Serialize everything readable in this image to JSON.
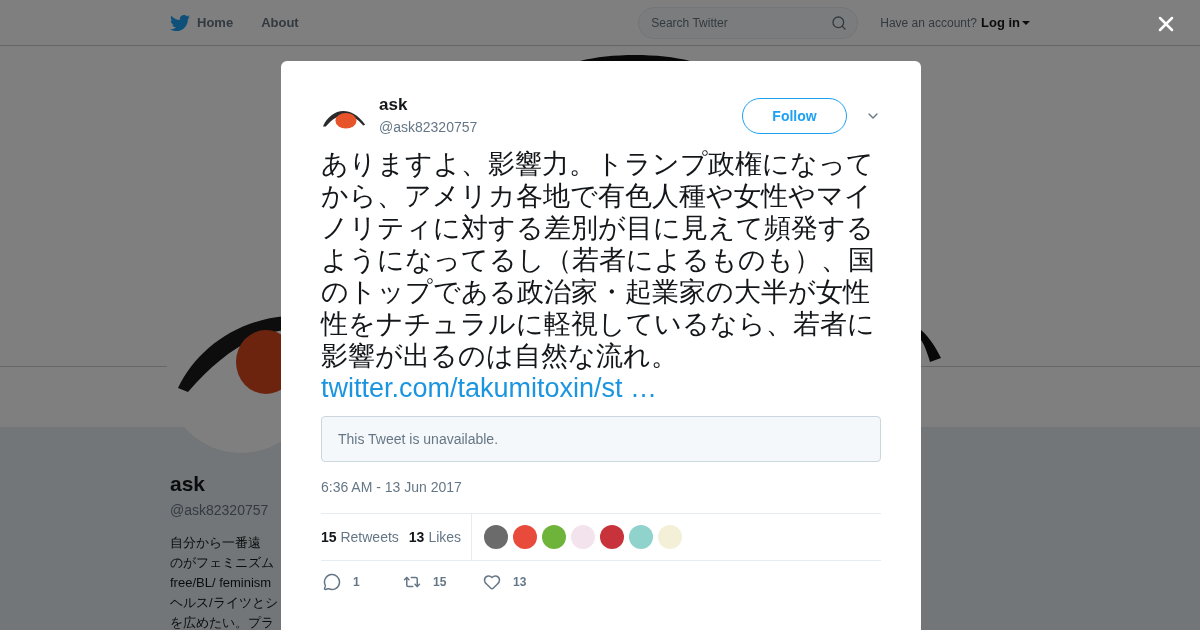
{
  "header": {
    "nav": [
      "Home",
      "About"
    ],
    "search": {
      "placeholder": "Search Twitter"
    },
    "account_prompt": "Have an account?",
    "login": "Log in"
  },
  "profile": {
    "name": "ask",
    "handle": "@ask82320757",
    "bio_lines": [
      "自分から一番遠",
      "のがフェミニズム",
      "free/BL/ feminism",
      "ヘルス/ライツとシ",
      "を広めたい。プラ"
    ]
  },
  "tweet": {
    "author": {
      "name": "ask",
      "handle": "@ask82320757"
    },
    "follow_button": "Follow",
    "text": "ありますよ、影響力。トランプ政権になってから、アメリカ各地で有色人種や女性やマイノリティに対する差別が目に見えて頻発するようになってるし（若者によるものも）、国のトップである政治家・起業家の大半が女性性をナチュラルに軽視しているなら、若者に影響が出るのは自然な流れ。",
    "link": "twitter.com/takumitoxin/st …",
    "quoted_notice": "This Tweet is unavailable.",
    "timestamp": "6:36 AM - 13 Jun 2017",
    "retweets": {
      "count": "15",
      "label": "Retweets"
    },
    "likes": {
      "count": "13",
      "label": "Likes"
    },
    "liker_avatars": [
      {
        "color": "#6b6b6b"
      },
      {
        "color": "#e84a3c"
      },
      {
        "color": "#6fb43a"
      },
      {
        "color": "#f3e3ec"
      },
      {
        "color": "#c8323a"
      },
      {
        "color": "#8fd3cc"
      },
      {
        "color": "#f4f0d8"
      }
    ],
    "actions": [
      {
        "kind": "reply",
        "count": "1"
      },
      {
        "kind": "retweet",
        "count": "15"
      },
      {
        "kind": "like",
        "count": "13"
      }
    ]
  }
}
